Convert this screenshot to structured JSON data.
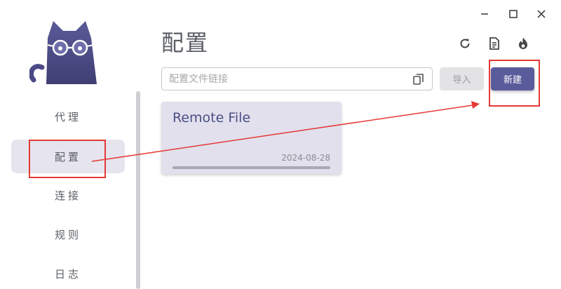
{
  "window": {
    "controls": [
      "minimize-icon",
      "maximize-icon",
      "close-icon"
    ]
  },
  "sidebar": {
    "items": [
      {
        "label": "代理",
        "active": false
      },
      {
        "label": "配置",
        "active": true
      },
      {
        "label": "连接",
        "active": false
      },
      {
        "label": "规则",
        "active": false
      },
      {
        "label": "日志",
        "active": false
      }
    ]
  },
  "header": {
    "title": "配置",
    "icons": [
      "reload-icon",
      "log-icon",
      "fire-icon"
    ]
  },
  "url_input": {
    "placeholder": "配置文件链接",
    "value": ""
  },
  "buttons": {
    "import_label": "导入",
    "create_label": "新建"
  },
  "profiles": [
    {
      "name": "Remote File",
      "date": "2024-08-28",
      "progress": 1.0
    }
  ],
  "colors": {
    "accent": "#5a5b9a",
    "card_bg": "#e1e0ec",
    "annotation": "#e53935",
    "logo": "#4e4e8a"
  }
}
